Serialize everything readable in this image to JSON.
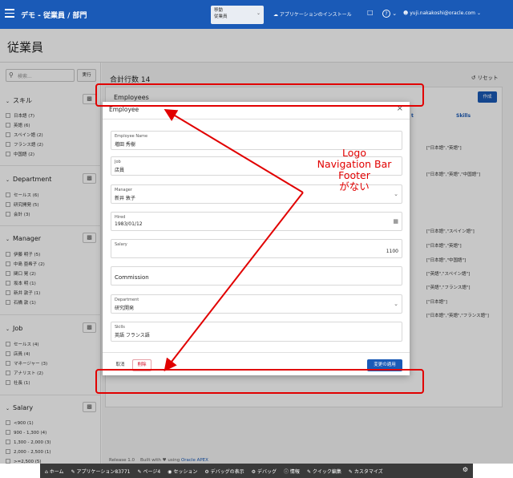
{
  "header": {
    "app_title": "デモ - 従業員 / 部門",
    "nav_select_label": "移動",
    "nav_select_value": "従業員",
    "install": "アプリケーションのインストール",
    "help": "?",
    "user": "yuji.nakakoshi@oracle.com"
  },
  "page": {
    "title": "従業員"
  },
  "search": {
    "placeholder": "検索...",
    "button": "実行"
  },
  "facets": [
    {
      "name": "スキル",
      "options": [
        "日本語 (7)",
        "英語 (6)",
        "スペイン語 (2)",
        "フランス語 (2)",
        "中国語 (2)"
      ]
    },
    {
      "name": "Department",
      "options": [
        "セールス (6)",
        "研究開発 (5)",
        "会計 (3)"
      ]
    },
    {
      "name": "Manager",
      "options": [
        "伊藤 明子 (5)",
        "中島 亜希子 (2)",
        "関口 晃 (2)",
        "坂本 明 (1)",
        "新井 敦子 (1)",
        "石橋 敦 (1)"
      ]
    },
    {
      "name": "Job",
      "options": [
        "セールス (4)",
        "店員 (4)",
        "マネージャー (3)",
        "アナリスト (2)",
        "社長 (1)"
      ]
    },
    {
      "name": "Salary",
      "options": [
        "<900 (1)",
        "900 - 1,300 (4)",
        "1,300 - 2,000 (3)",
        "2,000 - 2,500 (1)",
        ">=2,500 (5)"
      ]
    }
  ],
  "report": {
    "total_rows": "合計行数 14",
    "reset": "リセット",
    "region_title": "Employees",
    "create": "作成",
    "col_partial": "t",
    "col_skills": "Skills",
    "skills": [
      "[\"日本語\",\"英語\"]",
      "[\"日本語\",\"英語\",\"中国語\"]",
      "[\"日本語\",\"スペイン語\"]",
      "[\"日本語\",\"英語\"]",
      "[\"日本語\",\"中国語\"]",
      "[\"英語\",\"スペイン語\"]",
      "[\"英語\",\"フランス語\"]",
      "[\"日本語\"]",
      "[\"日本語\",\"英語\",\"フランス語\"]"
    ]
  },
  "footer": {
    "release": "Release 1.0",
    "built_with": "Built with",
    "using": "using",
    "apex": "Oracle APEX"
  },
  "dialog": {
    "title": "Employee",
    "fields": {
      "name": {
        "label": "Employee Name",
        "value": "増田 秀樹"
      },
      "job": {
        "label": "Job",
        "value": "店員"
      },
      "manager": {
        "label": "Manager",
        "value": "新井 敦子"
      },
      "hired": {
        "label": "Hired",
        "value": "1983/01/12"
      },
      "salary": {
        "label": "Salary",
        "value": "1100"
      },
      "commission": {
        "label": "Commission"
      },
      "department": {
        "label": "Department",
        "value": "研究開発"
      },
      "skills": {
        "label": "Skills",
        "value": "英語 フランス語"
      }
    },
    "cancel": "取消",
    "delete": "削除",
    "apply": "変更の適用"
  },
  "annotation": {
    "line1": "Logo",
    "line2": "Navigation Bar",
    "line3": "Footer",
    "line4": "がない",
    "color": "#e10000"
  },
  "devbar": {
    "items": [
      "ホーム",
      "アプリケーション83771",
      "ページ4",
      "セッション",
      "デバッグの表示",
      "デバッグ",
      "情報",
      "クイック編集",
      "カスタマイズ"
    ]
  },
  "colors": {
    "brand": "#1a5ab7",
    "danger": "#d0021b"
  }
}
